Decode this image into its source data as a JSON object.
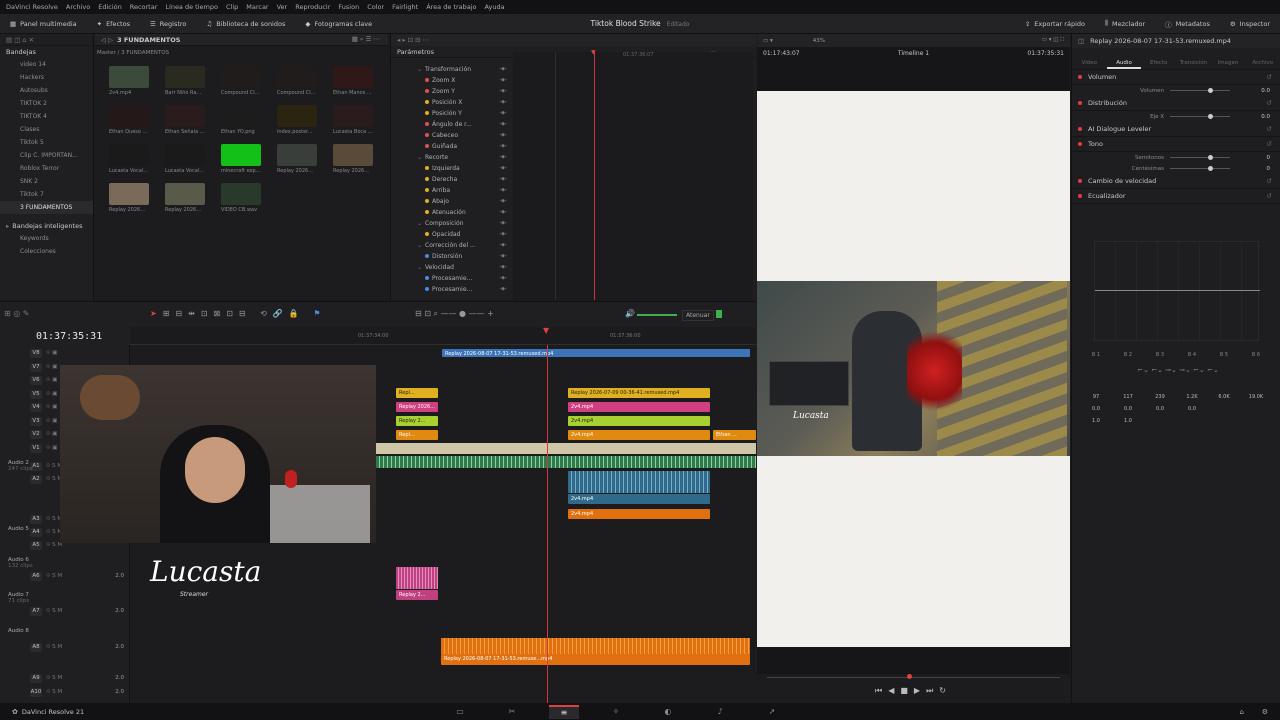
{
  "menu": [
    "DaVinci Resolve",
    "Archivo",
    "Edición",
    "Recortar",
    "Línea de tiempo",
    "Clip",
    "Marcar",
    "Ver",
    "Reproducir",
    "Fusion",
    "Color",
    "Fairlight",
    "Área de trabajo",
    "Ayuda"
  ],
  "toolbar": {
    "left": [
      "Panel multimedia",
      "Efectos",
      "Registro",
      "Biblioteca de sonidos",
      "Fotogramas clave"
    ],
    "project_title": "Tiktok Blood Strike",
    "project_status": "Editado",
    "right": [
      "Exportar rápido",
      "Mezclador",
      "Metadatos",
      "Inspector"
    ]
  },
  "media_pool": {
    "header": "Bandejas",
    "breadcrumb": "3 FUNDAMENTOS",
    "path": "Master / 3 FUNDAMENTOS",
    "bins": [
      "video 14",
      "Hackers",
      "Autosubs",
      "TIKTOK 2",
      "TIKTOK 4",
      "Clases",
      "Tiktok 5",
      "Clip C. IMPORTAN...",
      "Roblox Terror",
      "SNK 2",
      "Tiktok 7",
      "3 FUNDAMENTOS"
    ],
    "smart_header": "Bandejas inteligentes",
    "smart_items": [
      "Keywords",
      "Colecciones"
    ],
    "clips": [
      "2v4.mp4",
      "Barr Niño Ra...",
      "Compound Cl...",
      "Compound Cl...",
      "Ethan Manos ...",
      "Ethan Queso ...",
      "Ethan Señala ...",
      "Ethan YO.png",
      "index.poster...",
      "Lucasta Boca ...",
      "Lucasta Vocal...",
      "Lucasta Vocal...",
      "minecraft exp...",
      "Replay 2026...",
      "Replay 2026...",
      "Replay 2026...",
      "Replay 2026...",
      "VIDEO CB.wav"
    ]
  },
  "keyframes": {
    "header": "Parámetros",
    "timecode_a": "01:37:36:07",
    "rows": [
      {
        "label": "Transformación",
        "group": true
      },
      {
        "label": "Zoom X",
        "color": "#e05050"
      },
      {
        "label": "Zoom Y",
        "color": "#e05050"
      },
      {
        "label": "Posición X",
        "color": "#e0b020"
      },
      {
        "label": "Posición Y",
        "color": "#e0b020"
      },
      {
        "label": "Ángulo de r...",
        "color": "#e05050"
      },
      {
        "label": "Cabeceo",
        "color": "#e05050"
      },
      {
        "label": "Guiñada",
        "color": "#e05050"
      },
      {
        "label": "Recorte",
        "group": true
      },
      {
        "label": "Izquierda",
        "color": "#e0b020"
      },
      {
        "label": "Derecha",
        "color": "#e0b020"
      },
      {
        "label": "Arriba",
        "color": "#e0b020"
      },
      {
        "label": "Abajo",
        "color": "#e0b020"
      },
      {
        "label": "Atenuación",
        "color": "#e0b020"
      },
      {
        "label": "Composición",
        "group": true
      },
      {
        "label": "Opacidad",
        "color": "#e0b020"
      },
      {
        "label": "Corrección del ...",
        "group": true
      },
      {
        "label": "Distorsión",
        "color": "#4a8ae0"
      },
      {
        "label": "Velocidad",
        "group": true
      },
      {
        "label": "Procesamie...",
        "color": "#4a8ae0"
      },
      {
        "label": "Procesamie...",
        "color": "#4a8ae0"
      }
    ]
  },
  "viewer": {
    "zoom": "43%",
    "timecode_left": "01:17:43:07",
    "timeline_name": "Timeline 1",
    "timecode_right": "01:37:35:31",
    "watermark": "Lucasta"
  },
  "timeline": {
    "timecode": "01:37:35:31",
    "ruler": [
      "01:37:34:00",
      "01:37:36:00"
    ],
    "attenuate": "Atenuar",
    "video_tracks": [
      "V8",
      "V7",
      "V6",
      "V5",
      "V4",
      "V3",
      "V2",
      "V1"
    ],
    "audio_tracks": [
      {
        "id": "A1",
        "name": "",
        "info": ""
      },
      {
        "id": "A2",
        "name": "Audio 2",
        "info": "247 clips"
      },
      {
        "id": "A3",
        "name": "",
        "info": ""
      },
      {
        "id": "A4",
        "name": "",
        "info": ""
      },
      {
        "id": "A5",
        "name": "Audio 5",
        "info": ""
      },
      {
        "id": "A6",
        "name": "Audio 6",
        "info": "132 clips"
      },
      {
        "id": "A7",
        "name": "Audio 7",
        "info": "71 clips"
      },
      {
        "id": "A8",
        "name": "Audio 8",
        "info": ""
      },
      {
        "id": "A9",
        "name": "",
        "info": ""
      },
      {
        "id": "A10",
        "name": "",
        "info": ""
      }
    ],
    "volume_value": "2.0",
    "clips": {
      "v8": "Replay 2026-08-07 17-31-53.remuxed.mp4",
      "v5a": "Repl...",
      "v5b": "Replay 2026-07-09 00-36-41.remuxed.mp4",
      "v4a": "Replay 2026...",
      "v4b": "2v4.mp4",
      "v3a": "Replay 2...",
      "v3b": "2v4.mp4",
      "v2a": "Repl...",
      "v2b": "2v4.mp4",
      "v2c": "Ethan ...",
      "a2": "2v4.mp4",
      "a3": "2v4.mp4",
      "a6": "Replay 2...",
      "a8": "Replay 2026-08-07 17-31-53.remuxe...mp4"
    },
    "logo_main": "Lucasta",
    "logo_sub": "Streamer"
  },
  "inspector": {
    "file": "Replay 2026-08-07 17-31-53.remuxed.mp4",
    "tabs": [
      "Video",
      "Audio",
      "Efecto",
      "Transición",
      "Imagen",
      "Archivo"
    ],
    "sections": [
      {
        "title": "Volumen",
        "rows": [
          {
            "label": "Volumen",
            "value": "0.0"
          }
        ]
      },
      {
        "title": "Distribución",
        "rows": [
          {
            "label": "Eje X",
            "value": "0.0"
          }
        ]
      },
      {
        "title": "AI Dialogue Leveler",
        "rows": []
      },
      {
        "title": "Tono",
        "rows": [
          {
            "label": "Semitonos",
            "value": "0"
          },
          {
            "label": "Centésimas",
            "value": "0"
          }
        ]
      },
      {
        "title": "Cambio de velocidad",
        "rows": []
      },
      {
        "title": "Ecualizador",
        "rows": []
      }
    ],
    "eq_bands": [
      "B 1",
      "B 2",
      "B 3",
      "B 4",
      "B 5",
      "B 6"
    ],
    "eq_freq": [
      "97",
      "117",
      "239",
      "1.2K",
      "6.0K",
      "19.0K"
    ],
    "eq_gain": [
      "0.0",
      "0.0",
      "0.0",
      "0.0"
    ],
    "eq_q": [
      "1.0",
      "1.0"
    ]
  },
  "status": {
    "app": "DaVinci Resolve 21"
  }
}
